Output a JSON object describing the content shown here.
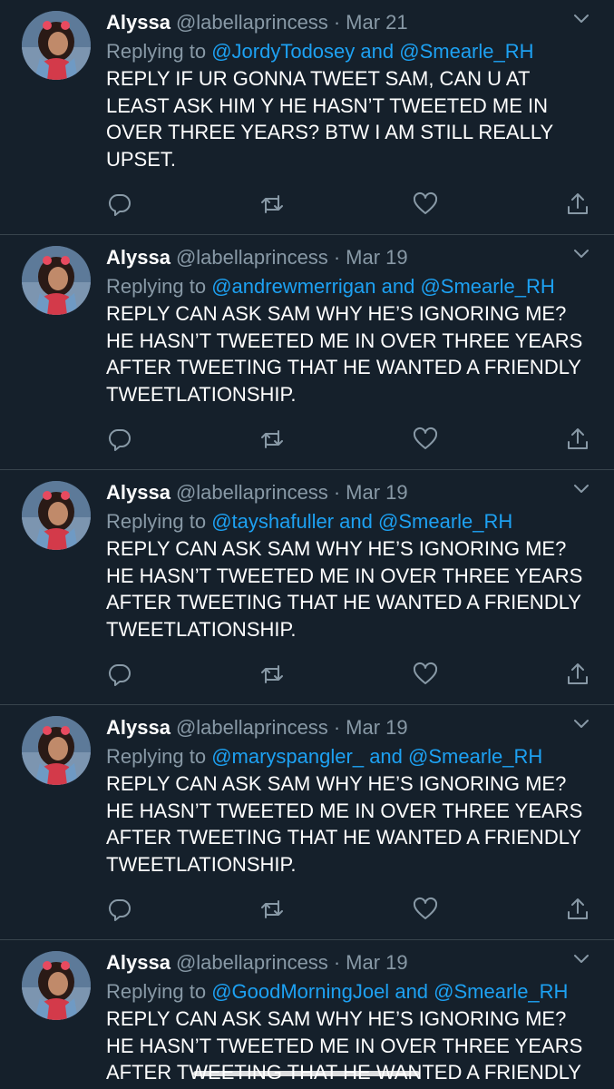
{
  "colors": {
    "background": "#15202b",
    "divider": "#38444d",
    "secondary_text": "#8899a6",
    "mention": "#1da1f2"
  },
  "tweets": [
    {
      "name": "Alyssa",
      "handle": "@labellaprincess",
      "separator": "·",
      "date": "Mar 21",
      "replying_prefix": "Replying to",
      "mention_1": "@JordyTodosey",
      "conjunction": "and",
      "mention_2": "@Smearle_RH",
      "text": "REPLY IF UR GONNA TWEET SAM, CAN U AT LEAST ASK HIM Y HE HASN’T TWEETED ME IN OVER THREE YEARS? BTW I AM STILL REALLY UPSET."
    },
    {
      "name": "Alyssa",
      "handle": "@labellaprincess",
      "separator": "·",
      "date": "Mar 19",
      "replying_prefix": "Replying to",
      "mention_1": "@andrewmerrigan",
      "conjunction": "and",
      "mention_2": "@Smearle_RH",
      "text": "REPLY CAN ASK SAM WHY HE’S IGNORING ME? HE HASN’T TWEETED ME IN OVER THREE YEARS AFTER TWEETING THAT HE WANTED A FRIENDLY TWEETLATIONSHIP."
    },
    {
      "name": "Alyssa",
      "handle": "@labellaprincess",
      "separator": "·",
      "date": "Mar 19",
      "replying_prefix": "Replying to",
      "mention_1": "@tayshafuller",
      "conjunction": "and",
      "mention_2": "@Smearle_RH",
      "text": "REPLY CAN ASK SAM WHY HE’S IGNORING ME? HE HASN’T TWEETED ME IN OVER THREE YEARS AFTER TWEETING THAT HE WANTED A FRIENDLY TWEETLATIONSHIP."
    },
    {
      "name": "Alyssa",
      "handle": "@labellaprincess",
      "separator": "·",
      "date": "Mar 19",
      "replying_prefix": "Replying to",
      "mention_1": "@maryspangler_",
      "conjunction": "and",
      "mention_2": "@Smearle_RH",
      "text": "REPLY CAN ASK SAM WHY HE’S IGNORING ME? HE HASN’T TWEETED ME IN OVER THREE YEARS AFTER TWEETING THAT HE WANTED A FRIENDLY TWEETLATIONSHIP."
    },
    {
      "name": "Alyssa",
      "handle": "@labellaprincess",
      "separator": "·",
      "date": "Mar 19",
      "replying_prefix": "Replying to",
      "mention_1": "@GoodMorningJoel",
      "conjunction": "and",
      "mention_2": "@Smearle_RH",
      "text": "REPLY CAN ASK SAM WHY HE’S IGNORING ME? HE HASN’T TWEETED ME IN OVER THREE YEARS AFTER TWEETING THAT HE WANTED A FRIENDLY"
    }
  ],
  "icons": {
    "reply": "reply-icon",
    "retweet": "retweet-icon",
    "like": "heart-icon",
    "share": "share-icon",
    "menu": "chevron-down-icon"
  }
}
